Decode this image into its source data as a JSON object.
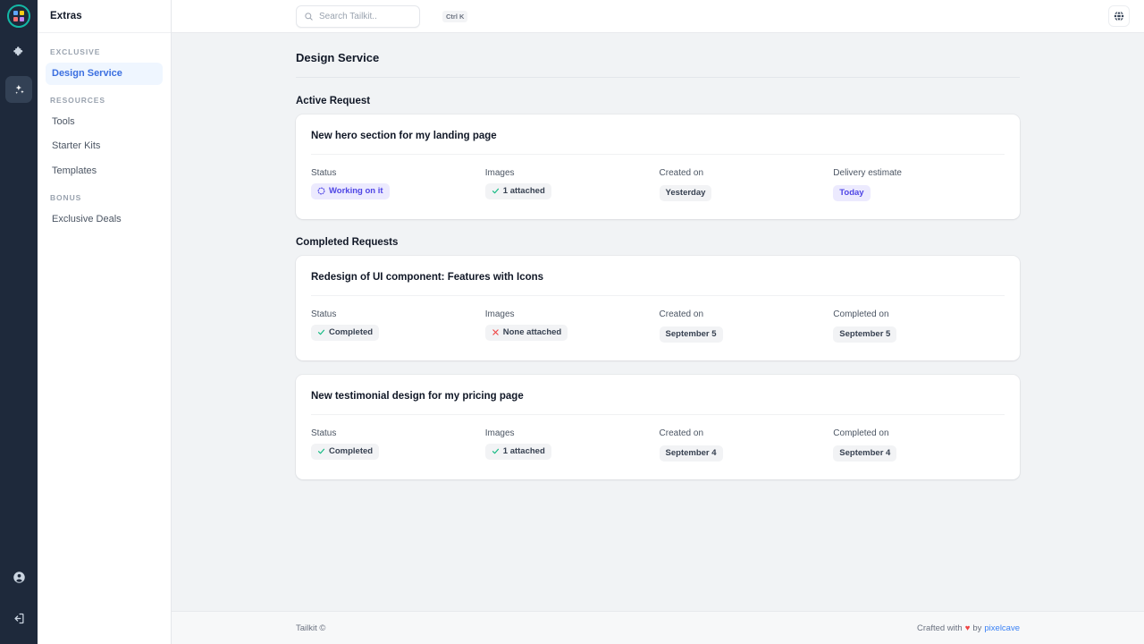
{
  "rail": {
    "logo_name": "tailkit-logo",
    "items": [
      {
        "name": "extensions-icon",
        "icon": "puzzle",
        "active": false
      },
      {
        "name": "extras-icon",
        "icon": "sparkles",
        "active": true
      }
    ],
    "bottom_items": [
      {
        "name": "account-icon",
        "icon": "user-circle"
      },
      {
        "name": "logout-icon",
        "icon": "logout"
      }
    ],
    "accent_color": "#14b8a6",
    "background_color": "#1e293b"
  },
  "sidebar": {
    "title": "Extras",
    "groups": [
      {
        "label": "EXCLUSIVE",
        "items": [
          {
            "label": "Design Service",
            "active": true
          }
        ]
      },
      {
        "label": "RESOURCES",
        "items": [
          {
            "label": "Tools",
            "active": false
          },
          {
            "label": "Starter Kits",
            "active": false
          },
          {
            "label": "Templates",
            "active": false
          }
        ]
      },
      {
        "label": "BONUS",
        "items": [
          {
            "label": "Exclusive Deals",
            "active": false
          }
        ]
      }
    ],
    "active_color": "#3b6fe0",
    "active_bg": "#eff6ff"
  },
  "topbar": {
    "search": {
      "value": "",
      "placeholder": "Search Tailkit..",
      "shortcut": "Ctrl K"
    },
    "language_button_label": "globe-icon"
  },
  "page": {
    "title": "Design Service",
    "sections": [
      {
        "title": "Active Request"
      },
      {
        "title": "Completed Requests"
      }
    ]
  },
  "requests": {
    "active": [
      {
        "title": "New hero section for my landing page",
        "fields": [
          {
            "label": "Status",
            "value": "Working on it",
            "style": "indigo",
            "icon": "spinner"
          },
          {
            "label": "Images",
            "value": "1 attached",
            "style": "gray",
            "icon": "check"
          },
          {
            "label": "Created on",
            "value": "Yesterday",
            "style": "gray",
            "icon": "none"
          },
          {
            "label": "Delivery estimate",
            "value": "Today",
            "style": "indigo",
            "icon": "none"
          }
        ]
      }
    ],
    "completed": [
      {
        "title": "Redesign of UI component: Features with Icons",
        "fields": [
          {
            "label": "Status",
            "value": "Completed",
            "style": "gray",
            "icon": "check"
          },
          {
            "label": "Images",
            "value": "None attached",
            "style": "gray",
            "icon": "cross"
          },
          {
            "label": "Created on",
            "value": "September 5",
            "style": "gray",
            "icon": "none"
          },
          {
            "label": "Completed on",
            "value": "September 5",
            "style": "gray",
            "icon": "none"
          }
        ]
      },
      {
        "title": "New testimonial design for my pricing page",
        "fields": [
          {
            "label": "Status",
            "value": "Completed",
            "style": "gray",
            "icon": "check"
          },
          {
            "label": "Images",
            "value": "1 attached",
            "style": "gray",
            "icon": "check"
          },
          {
            "label": "Created on",
            "value": "September 4",
            "style": "gray",
            "icon": "none"
          },
          {
            "label": "Completed on",
            "value": "September 4",
            "style": "gray",
            "icon": "none"
          }
        ]
      }
    ]
  },
  "footer": {
    "left": "Tailkit ©",
    "crafted_prefix": "Crafted with",
    "heart": "♥",
    "by": "by",
    "author": "pixelcave"
  },
  "colors": {
    "check_green": "#10b981",
    "cross_red": "#ef4444",
    "indigo": "#4f46e5",
    "heart_red": "#ef4444",
    "link_blue": "#3b82f6"
  }
}
